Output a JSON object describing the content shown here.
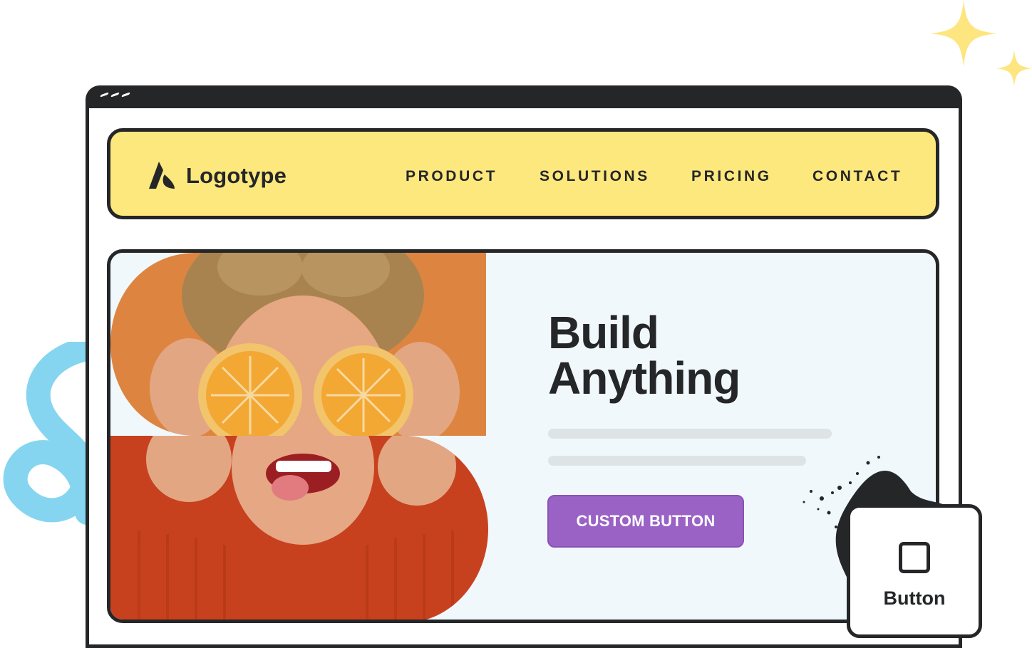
{
  "logo": {
    "text": "Logotype",
    "icon": "logo-mark-icon"
  },
  "nav": {
    "items": [
      {
        "label": "PRODUCT"
      },
      {
        "label": "SOLUTIONS"
      },
      {
        "label": "PRICING"
      },
      {
        "label": "CONTACT"
      }
    ]
  },
  "hero": {
    "headline_line1": "Build",
    "headline_line2": "Anything",
    "cta_label": "CUSTOM BUTTON",
    "image": "woman-holding-orange-halves-photo"
  },
  "widget": {
    "label": "Button",
    "icon": "square-icon"
  },
  "colors": {
    "nav_bg": "#fde87d",
    "frame": "#252628",
    "hero_bg": "#f1f8fb",
    "cta": "#9b62c6",
    "sparkle": "#fde680",
    "squiggle": "#7fd3ef"
  }
}
